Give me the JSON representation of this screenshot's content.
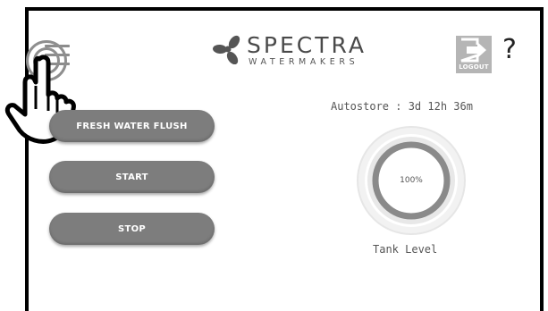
{
  "header": {
    "brand_name": "SPECTRA",
    "brand_subtitle": "WATERMAKERS",
    "logout_label": "LOGOUT",
    "help_label": "?"
  },
  "controls": {
    "fresh_water_flush_label": "FRESH WATER FLUSH",
    "start_label": "START",
    "stop_label": "STOP"
  },
  "status": {
    "autostore_text": "Autostore : 3d 12h 36m",
    "tank_level_percent": 100,
    "tank_level_text": "100%",
    "tank_level_caption": "Tank Level"
  },
  "colors": {
    "button": "#7d7d7d",
    "gauge_ring": "#8a8a8a",
    "gauge_track": "#e2e2e2",
    "logout_icon": "#b5b5b5"
  },
  "icons": {
    "menu": "hamburger-menu-icon",
    "brand": "propeller-logo-icon",
    "logout": "logout-arrow-icon",
    "touch": "pointing-hand-icon"
  }
}
